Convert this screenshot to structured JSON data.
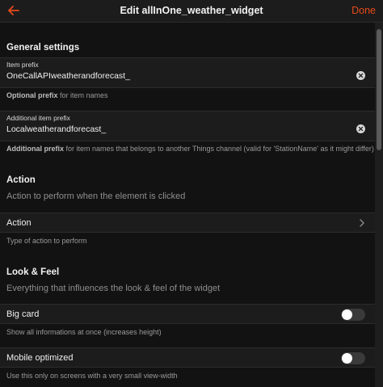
{
  "navbar": {
    "title": "Edit allInOne_weather_widget",
    "done_label": "Done",
    "accent_color": "#e64a19",
    "back_icon": "arrow-left-icon"
  },
  "general": {
    "title": "General settings",
    "item_prefix": {
      "label": "Item prefix",
      "value": "OneCallAPIweatherandforecast_",
      "footer_bold": "Optional prefix",
      "footer_rest": " for item names"
    },
    "additional_prefix": {
      "label": "Additional item prefix",
      "value": "Localweatherandforecast_",
      "footer_bold": "Additional prefix",
      "footer_rest": " for item names that belongs to another Things channel (valid for 'StationName' as it might differ)"
    }
  },
  "action": {
    "title": "Action",
    "description": "Action to perform when the element is clicked",
    "row_label": "Action",
    "footer": "Type of action to perform"
  },
  "look": {
    "title": "Look & Feel",
    "description": "Everything that influences the look & feel of the widget",
    "big_card": {
      "label": "Big card",
      "footer": "Show all informations at once (increases height)",
      "enabled": false
    },
    "mobile": {
      "label": "Mobile optimized",
      "footer": "Use this only on screens with a very small view-width",
      "enabled": false
    }
  }
}
